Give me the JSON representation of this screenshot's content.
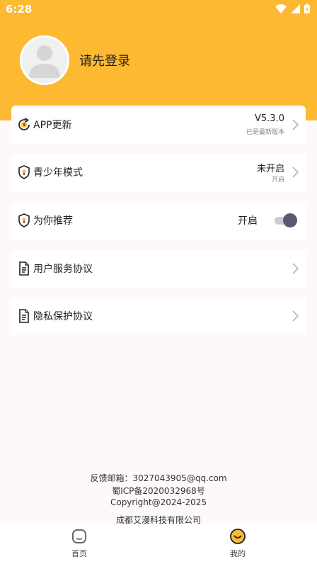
{
  "status_bar": {
    "time": "6:28"
  },
  "profile": {
    "login_text": "请先登录"
  },
  "settings": {
    "app_update": {
      "label": "APP更新",
      "version": "V5.3.0",
      "status": "已是最新版本"
    },
    "youth_mode": {
      "label": "青少年模式",
      "state": "未开启",
      "action": "开启"
    },
    "recommend": {
      "label": "为你推荐",
      "state": "开启",
      "enabled": true
    },
    "user_agreement": {
      "label": "用户服务协议"
    },
    "privacy_agreement": {
      "label": "隐私保护协议"
    }
  },
  "footer": {
    "email": "反馈邮箱：3027043905@qq.com",
    "icp": "蜀ICP备2020032968号",
    "copyright": "Copyright@2024-2025",
    "company": "成都艾漫科技有限公司"
  },
  "tabbar": {
    "home": {
      "label": "首页"
    },
    "mine": {
      "label": "我的"
    }
  },
  "colors": {
    "accent": "#fdb931",
    "toggle_knob": "#5e5672"
  }
}
